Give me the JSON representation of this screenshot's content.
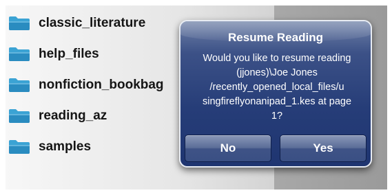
{
  "folders": [
    {
      "label": "classic_literature",
      "icon": "folder-icon"
    },
    {
      "label": "help_files",
      "icon": "folder-icon"
    },
    {
      "label": "nonfiction_bookbag",
      "icon": "folder-icon"
    },
    {
      "label": "reading_az",
      "icon": "folder-icon"
    },
    {
      "label": "samples",
      "icon": "folder-icon"
    }
  ],
  "dialog": {
    "title": "Resume Reading",
    "message_lines": [
      "Would you like to resume reading",
      "(jjones)\\Joe Jones",
      "/recently_opened_local_files/u",
      "singfireflyonanipad_1.kes at page",
      "1?"
    ],
    "no_label": "No",
    "yes_label": "Yes"
  },
  "colors": {
    "folder": "#3ba3d4",
    "dialog_bg": "#263d78",
    "dialog_border": "#e8ecf3"
  }
}
